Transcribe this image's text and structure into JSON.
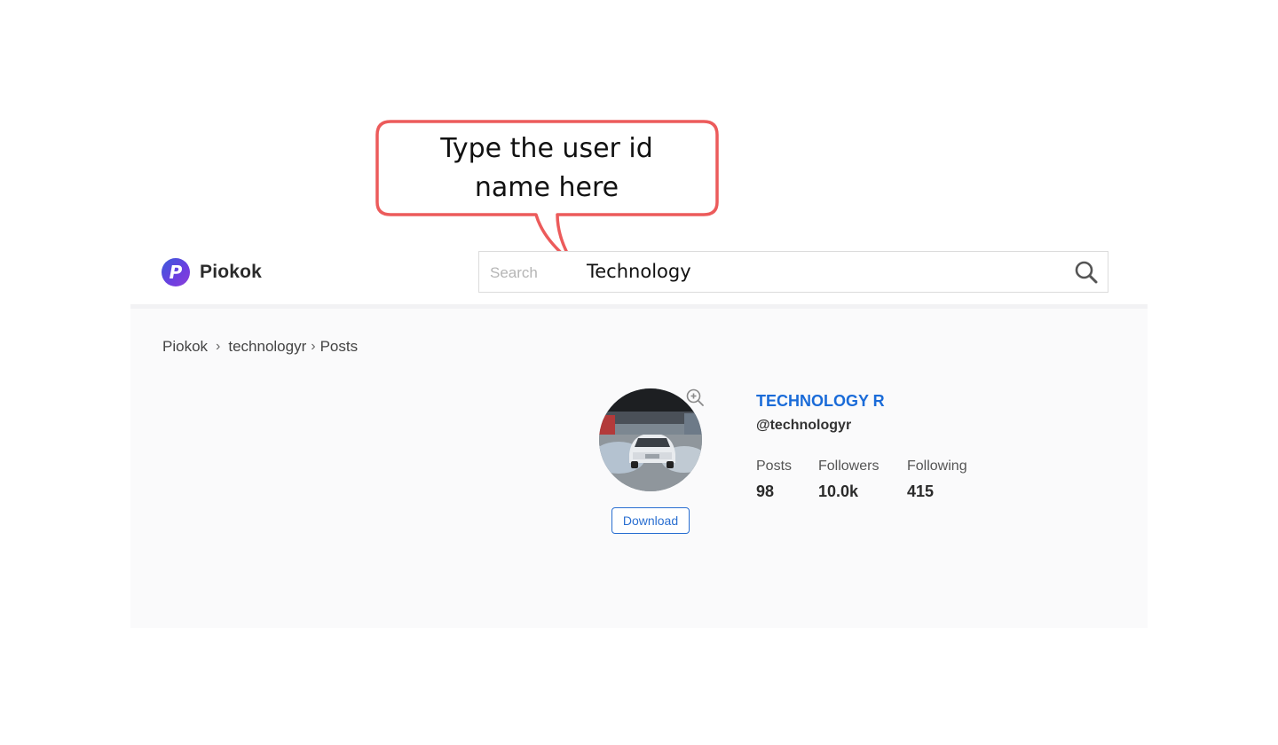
{
  "annotation": {
    "callout_line1": "Type the user id",
    "callout_line2": "name here",
    "callout_color": "#ec5b5b"
  },
  "header": {
    "logo_letter": "P",
    "logo_name": "Piokok",
    "search": {
      "placeholder": "Search",
      "value": "Technology",
      "button_icon": "search-icon"
    }
  },
  "breadcrumb": [
    "Piokok",
    "technologyr",
    "Posts"
  ],
  "profile": {
    "display_name": "TECHNOLOGY R",
    "handle": "@technologyr",
    "avatar_description": "car-photo",
    "zoom_icon": "zoom-in-icon",
    "download_label": "Download",
    "stats": [
      {
        "label": "Posts",
        "value": "98"
      },
      {
        "label": "Followers",
        "value": "10.0k"
      },
      {
        "label": "Following",
        "value": "415"
      }
    ]
  },
  "colors": {
    "accent": "#1a6bd8",
    "logo_gradient_start": "#3b5bdb",
    "logo_gradient_end": "#8b3fd9",
    "panel_bg": "#fafafb"
  }
}
